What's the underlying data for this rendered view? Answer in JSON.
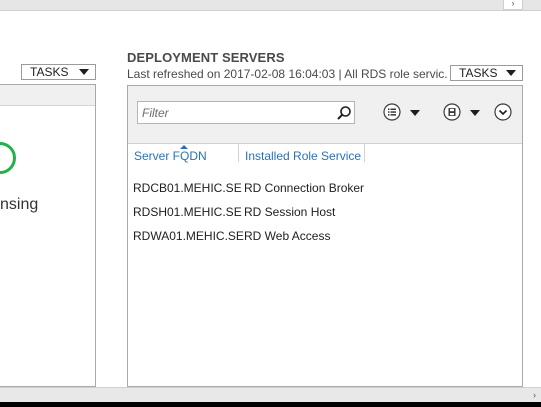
{
  "top_scrollbar": {
    "right_arrow": "›"
  },
  "left_panel": {
    "partial_label": "nsing",
    "tasks_label": "TASKS"
  },
  "deployment_servers": {
    "title": "DEPLOYMENT SERVERS",
    "subtitle": "Last refreshed on 2017-02-08 16:04:03 | All RDS role servic...",
    "tasks_label": "TASKS",
    "filter_placeholder": "Filter",
    "columns": [
      "Server FQDN",
      "Installed Role Service"
    ],
    "rows": [
      {
        "server": "RDCB01.MEHIC.SE",
        "role": "RD Connection Broker"
      },
      {
        "server": "RDSH01.MEHIC.SE",
        "role": "RD Session Host"
      },
      {
        "server": "RDWA01.MEHIC.SE",
        "role": "RD Web Access"
      }
    ]
  },
  "bottom_scrollbar": {
    "right_arrow": "›"
  },
  "colors": {
    "link_blue": "#2a72b5",
    "status_green": "#22b14c",
    "header_gray": "#4a4a4a"
  },
  "icons": {
    "search": "search-icon",
    "list_view": "list-view-icon",
    "save": "save-icon",
    "expand": "expand-circle-icon"
  }
}
